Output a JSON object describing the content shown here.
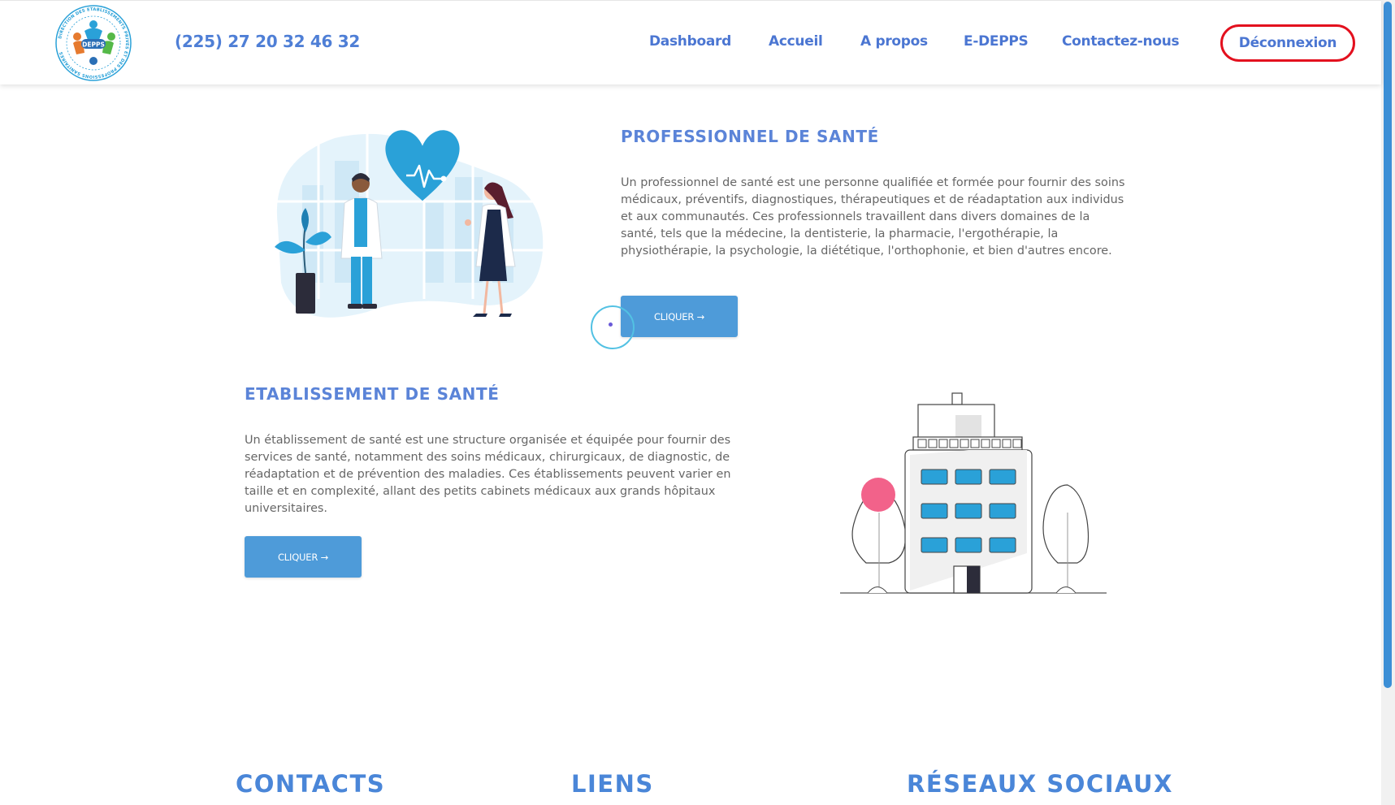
{
  "header": {
    "logo": {
      "acronym": "DEPPS",
      "ring_text": "DIRECTION DES ETABLISSEMENTS PRIVES ET DES PROFESSIONS SANITAIRES"
    },
    "phone": "(225) 27 20 32 46 32",
    "nav": [
      {
        "label": "Dashboard"
      },
      {
        "label": "Accueil"
      },
      {
        "label": "A propos"
      },
      {
        "label": "E-DEPPS"
      },
      {
        "label": "Contactez-nous"
      }
    ],
    "logout_label": "Déconnexion"
  },
  "sections": {
    "professionnel": {
      "title": "PROFESSIONNEL DE SANTÉ",
      "text": "Un professionnel de santé est une personne qualifiée et formée pour fournir des soins médicaux, préventifs, diagnostiques, thérapeutiques et de réadaptation aux individus et aux communautés. Ces professionnels travaillent dans divers domaines de la santé, tels que la médecine, la dentisterie, la pharmacie, l'ergothérapie, la physiothérapie, la psychologie, la diététique, l'orthophonie, et bien d'autres encore.",
      "button": "CLIQUER →"
    },
    "etablissement": {
      "title": "ETABLISSEMENT DE SANTÉ",
      "text": "Un établissement de santé est une structure organisée et équipée pour fournir des services de santé, notamment des soins médicaux, chirurgicaux, de diagnostic, de réadaptation et de prévention des maladies. Ces établissements peuvent varier en taille et en complexité, allant des petits cabinets médicaux aux grands hôpitaux universitaires.",
      "button": "CLIQUER →"
    }
  },
  "footer": {
    "contacts_title": "CONTACTS",
    "liens_title": "LIENS",
    "reseaux_title": "RÉSEAUX SOCIAUX"
  },
  "colors": {
    "accent_blue": "#4b76d2",
    "button_blue": "#4e9bd9",
    "logout_border": "#e3101e",
    "scrollbar": "#3c8fd6"
  }
}
